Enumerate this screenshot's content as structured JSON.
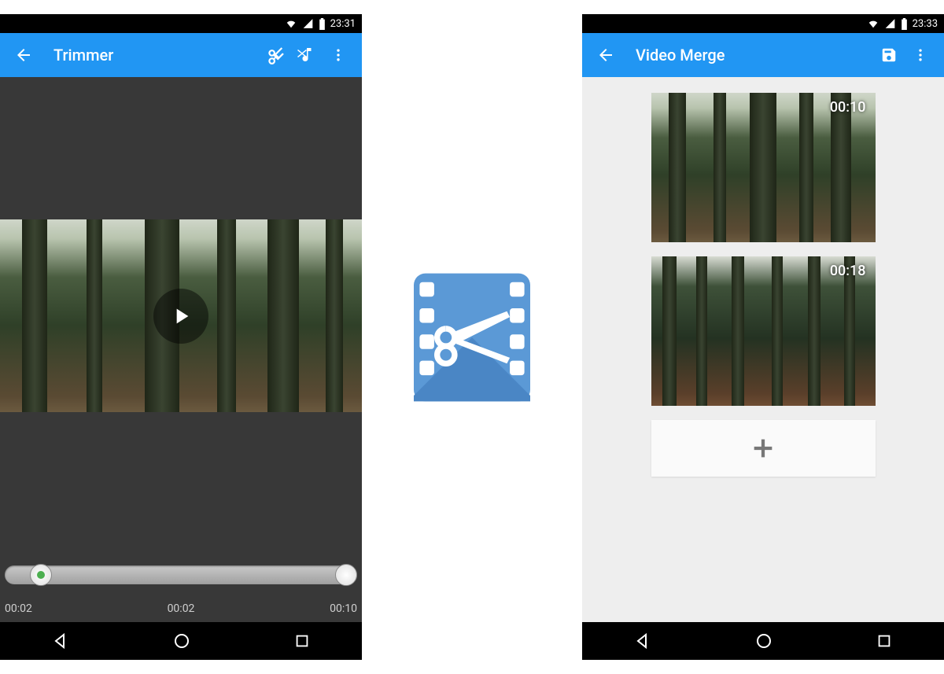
{
  "left": {
    "statusbar_time": "23:31",
    "toolbar": {
      "title": "Trimmer"
    },
    "playback": {
      "start_time": "00:02",
      "current_time": "00:02",
      "end_time": "00:10"
    }
  },
  "right": {
    "statusbar_time": "23:33",
    "toolbar": {
      "title": "Video Merge"
    },
    "clips": [
      {
        "duration": "00:10"
      },
      {
        "duration": "00:18"
      }
    ]
  },
  "icons": {
    "back": "back-arrow",
    "cut": "scissors-icon",
    "music": "music-cut-icon",
    "overflow": "more-vert-icon",
    "save": "save-icon",
    "add": "plus-icon",
    "play": "play-icon",
    "wifi": "wifi-icon",
    "signal": "signal-icon",
    "battery": "battery-icon",
    "nav_back": "nav-back",
    "nav_home": "nav-home",
    "nav_recent": "nav-recent"
  }
}
